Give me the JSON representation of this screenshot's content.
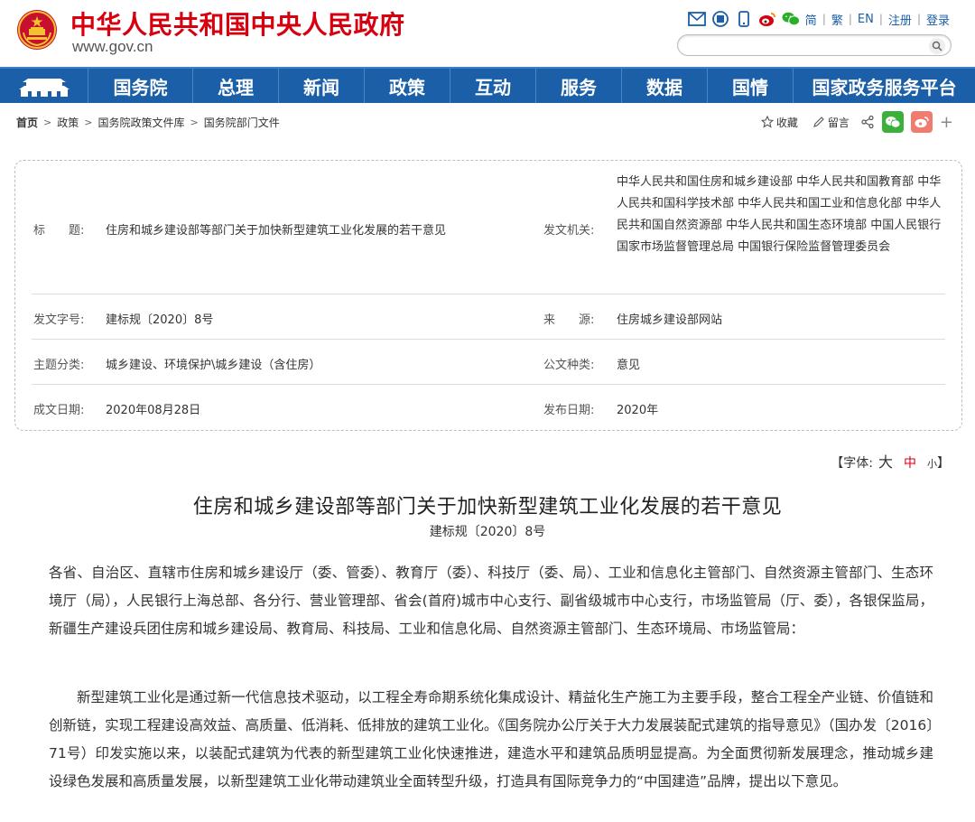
{
  "header": {
    "site_title": "中华人民共和国中央人民政府",
    "site_domain": "www.gov.cn",
    "links": [
      "简",
      "繁",
      "EN",
      "注册",
      "登录"
    ],
    "search_placeholder": ""
  },
  "nav": {
    "items": [
      "国务院",
      "总理",
      "新闻",
      "政策",
      "互动",
      "服务",
      "数据",
      "国情",
      "国家政务服务平台"
    ]
  },
  "breadcrumb": [
    "首页",
    "政策",
    "国务院政策文件库",
    "国务院部门文件"
  ],
  "share": {
    "favorite": "收藏",
    "comment": "留言"
  },
  "info": {
    "title_label": "标　　题:",
    "title_value": "住房和城乡建设部等部门关于加快新型建筑工业化发展的若干意见",
    "issuer_label": "发文机关:",
    "issuer_value": "中华人民共和国住房和城乡建设部 中华人民共和国教育部 中华人民共和国科学技术部 中华人民共和国工业和信息化部 中华人民共和国自然资源部 中华人民共和国生态环境部 中国人民银行 国家市场监督管理总局 中国银行保险监督管理委员会",
    "docno_label": "发文字号:",
    "docno_value": "建标规〔2020〕8号",
    "source_label": "来　　源:",
    "source_value": "住房城乡建设部网站",
    "subject_label": "主题分类:",
    "subject_value": "城乡建设、环境保护\\城乡建设（含住房）",
    "type_label": "公文种类:",
    "type_value": "意见",
    "written_label": "成文日期:",
    "written_value": "2020年08月28日",
    "published_label": "发布日期:",
    "published_value": "2020年"
  },
  "fontsize": {
    "prefix": "【字体:",
    "big": "大",
    "medium": "中",
    "small": "小",
    "suffix": "】"
  },
  "article": {
    "title": "住房和城乡建设部等部门关于加快新型建筑工业化发展的若干意见",
    "number": "建标规〔2020〕8号",
    "addressee": "各省、自治区、直辖市住房和城乡建设厅（委、管委）、教育厅（委）、科技厅（委、局）、工业和信息化主管部门、自然资源主管部门、生态环境厅（局），人民银行上海总部、各分行、营业管理部、省会(首府)城市中心支行、副省级城市中心支行，市场监管局（厅、委），各银保监局，新疆生产建设兵团住房和城乡建设局、教育局、科技局、工业和信息化局、自然资源主管部门、生态环境局、市场监管局：",
    "paragraph1": "新型建筑工业化是通过新一代信息技术驱动，以工程全寿命期系统化集成设计、精益化生产施工为主要手段，整合工程全产业链、价值链和创新链，实现工程建设高效益、高质量、低消耗、低排放的建筑工业化。《国务院办公厅关于大力发展装配式建筑的指导意见》（国办发〔2016〕71号）印发实施以来，以装配式建筑为代表的新型建筑工业化快速推进，建造水平和建筑品质明显提高。为全面贯彻新发展理念，推动城乡建设绿色发展和高质量发展，以新型建筑工业化带动建筑业全面转型升级，打造具有国际竞争力的“中国建造”品牌，提出以下意见。"
  },
  "colors": {
    "brand_red": "#d7000f",
    "nav_blue": "#1a5fa8",
    "link_blue": "#1a5fa8"
  }
}
